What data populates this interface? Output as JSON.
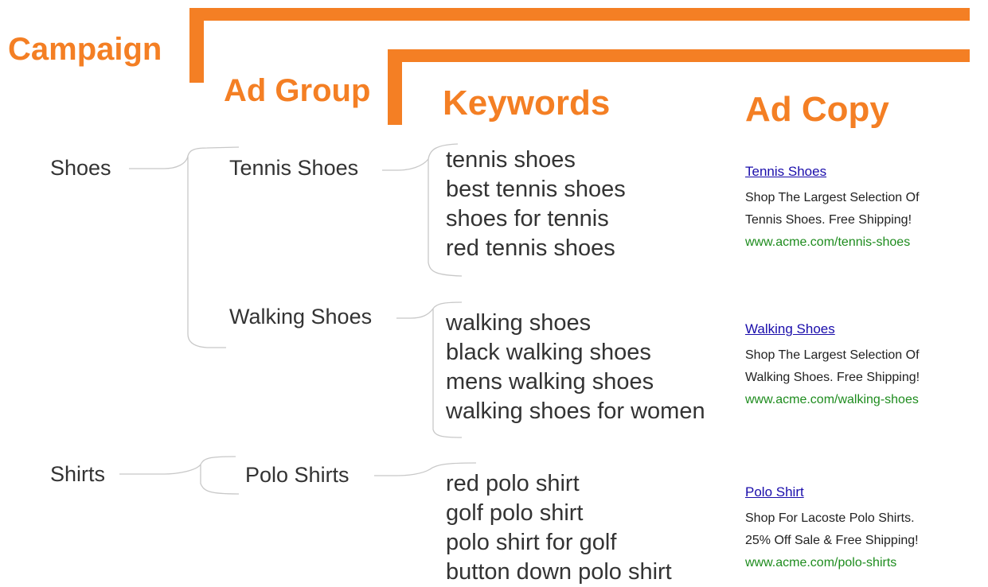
{
  "headings": {
    "campaign": "Campaign",
    "ad_group": "Ad Group",
    "keywords": "Keywords",
    "ad_copy": "Ad Copy"
  },
  "campaigns": [
    {
      "name": "Shoes"
    },
    {
      "name": "Shirts"
    }
  ],
  "ad_groups": [
    {
      "name": "Tennis Shoes",
      "keywords": [
        "tennis shoes",
        "best tennis shoes",
        "shoes for tennis",
        "red tennis shoes"
      ],
      "ad": {
        "title": "Tennis Shoes",
        "line1": "Shop The Largest Selection Of",
        "line2": "Tennis Shoes. Free Shipping!",
        "url": "www.acme.com/tennis-shoes"
      }
    },
    {
      "name": "Walking Shoes",
      "keywords": [
        "walking shoes",
        "black walking shoes",
        "mens walking shoes",
        "walking shoes for women"
      ],
      "ad": {
        "title": "Walking Shoes",
        "line1": "Shop The Largest Selection Of",
        "line2": "Walking Shoes. Free Shipping!",
        "url": "www.acme.com/walking-shoes"
      }
    },
    {
      "name": "Polo Shirts",
      "keywords": [
        "red polo shirt",
        "golf polo shirt",
        "polo shirt for golf",
        "button down polo shirt"
      ],
      "ad": {
        "title": "Polo Shirt",
        "line1": "Shop For Lacoste Polo Shirts.",
        "line2": "25% Off Sale & Free Shipping!",
        "url": "www.acme.com/polo-shirts"
      }
    }
  ],
  "colors": {
    "accent": "#f47f24",
    "link": "#1a0dab",
    "url": "#1e8c1e",
    "text": "#333333",
    "connector": "#c8c8c8"
  }
}
